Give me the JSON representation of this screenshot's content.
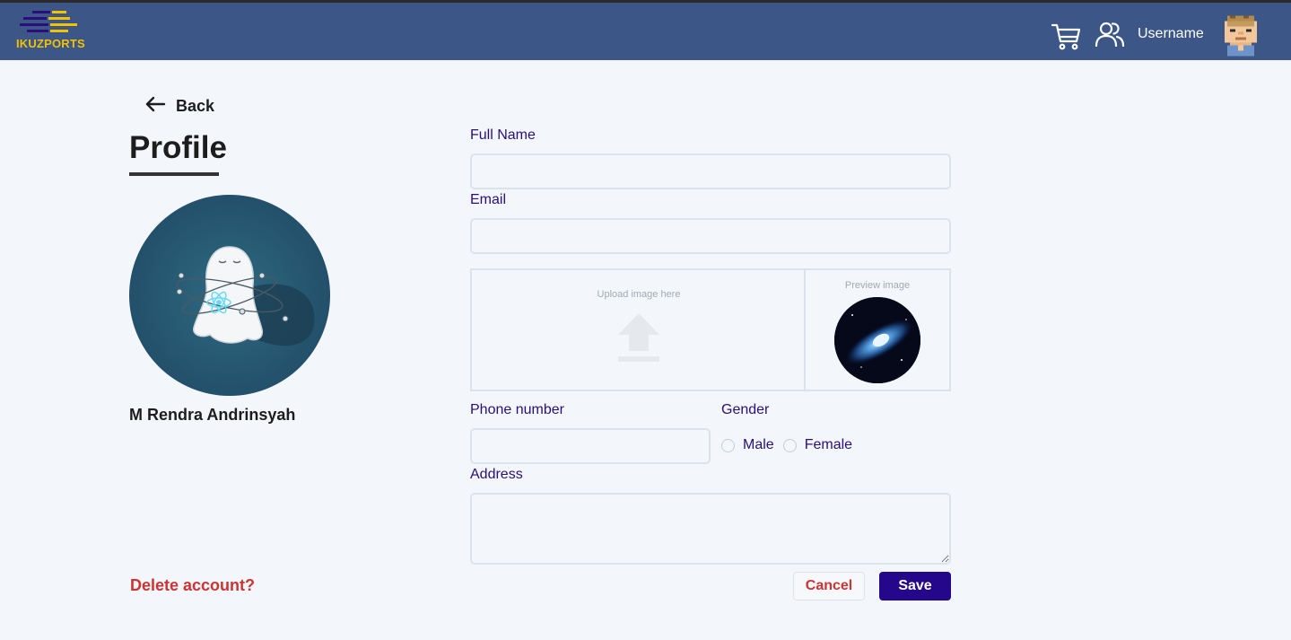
{
  "header": {
    "logo_text": "IKUZPORTS",
    "username": "Username",
    "icons": [
      "cart-icon",
      "users-icon",
      "user-avatar"
    ]
  },
  "sidebar": {
    "back_label": "Back",
    "page_title": "Profile",
    "profile_name": "M Rendra Andrinsyah",
    "delete_label": "Delete account?"
  },
  "form": {
    "full_name_label": "Full Name",
    "full_name_value": "",
    "email_label": "Email",
    "email_value": "",
    "upload_text": "Upload image here",
    "preview_text": "Preview image",
    "phone_label": "Phone number",
    "phone_value": "",
    "gender_label": "Gender",
    "gender_options": [
      "Male",
      "Female"
    ],
    "address_label": "Address",
    "address_value": "",
    "cancel_label": "Cancel",
    "save_label": "Save"
  },
  "colors": {
    "header_bg": "#3b5687",
    "logo_yellow": "#f2c200",
    "label_purple": "#2a0f7a",
    "danger": "#cc3333",
    "primary": "#24078a",
    "page_bg": "#f3f6fb"
  }
}
